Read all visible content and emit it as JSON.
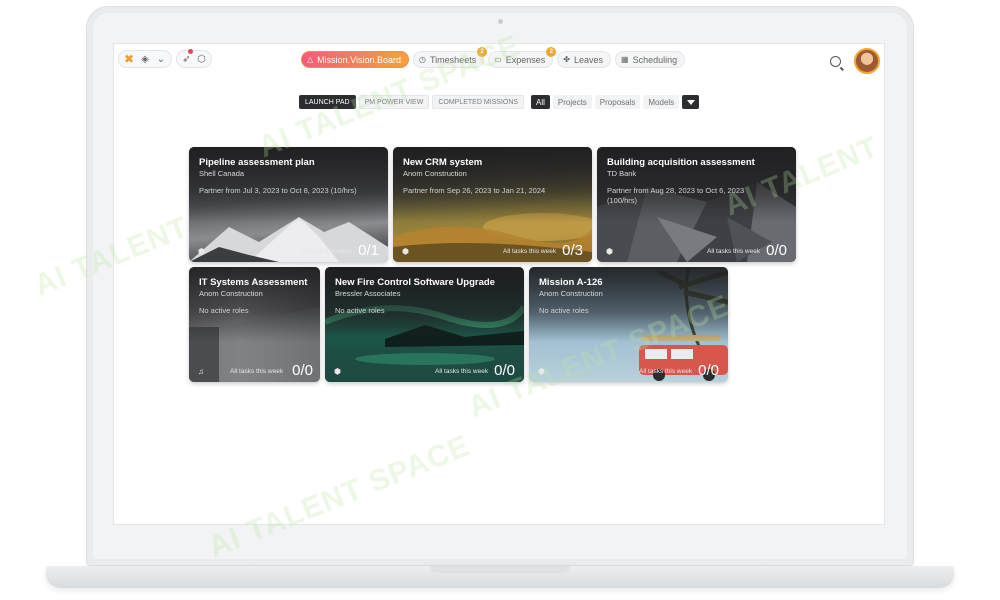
{
  "topbar": {
    "nav_tabs": [
      {
        "label": "Mission.Vision.Board",
        "icon": "triangle-icon",
        "active": true
      },
      {
        "label": "Timesheets",
        "icon": "clock-icon",
        "badge": "2"
      },
      {
        "label": "Expenses",
        "icon": "receipt-icon",
        "badge": "2"
      },
      {
        "label": "Leaves",
        "icon": "leaf-icon"
      },
      {
        "label": "Scheduling",
        "icon": "calendar-icon"
      }
    ]
  },
  "subtabs": [
    {
      "label": "LAUNCH PAD",
      "active": true
    },
    {
      "label": "PM POWER VIEW",
      "active": false
    },
    {
      "label": "COMPLETED MISSIONS",
      "active": false
    }
  ],
  "filters": [
    {
      "label": "All",
      "active": true
    },
    {
      "label": "Projects",
      "active": false
    },
    {
      "label": "Proposals",
      "active": false
    },
    {
      "label": "Models",
      "active": false
    }
  ],
  "cards": [
    {
      "title": "Pipeline assessment plan",
      "client": "Shell Canada",
      "period": "Partner from Jul 3, 2023 to Oct 8, 2023 (10/hrs)",
      "footer_label": "All tasks this week",
      "count": "0/1",
      "icon": "cube-icon"
    },
    {
      "title": "New CRM system",
      "client": "Anom Construction",
      "period": "Partner from Sep 26, 2023 to Jan 21, 2024",
      "footer_label": "All tasks this week",
      "count": "0/3",
      "icon": "cube-icon"
    },
    {
      "title": "Building acquisition assessment",
      "client": "TD Bank",
      "period": "Partner from Aug 28, 2023 to Oct 6, 2023 (100/hrs)",
      "footer_label": "All tasks this week",
      "count": "0/0",
      "icon": "cube-icon"
    },
    {
      "title": "IT Systems Assessment",
      "client": "Anom Construction",
      "period": "No active roles",
      "footer_label": "All tasks this week",
      "count": "0/0",
      "icon": "music-icon"
    },
    {
      "title": "New Fire Control Software Upgrade",
      "client": "Bressler Associates",
      "period": "No active roles",
      "footer_label": "All tasks this week",
      "count": "0/0",
      "icon": "cube-icon"
    },
    {
      "title": "Mission A-126",
      "client": "Anom Construction",
      "period": "No active roles",
      "footer_label": "All tasks this week",
      "count": "0/0",
      "icon": "cube-icon"
    }
  ],
  "colors": {
    "accent_gradient_start": "#f55a7a",
    "accent_gradient_end": "#f7a23a",
    "badge": "#f3a531",
    "dark_tab": "#2b2d31"
  }
}
